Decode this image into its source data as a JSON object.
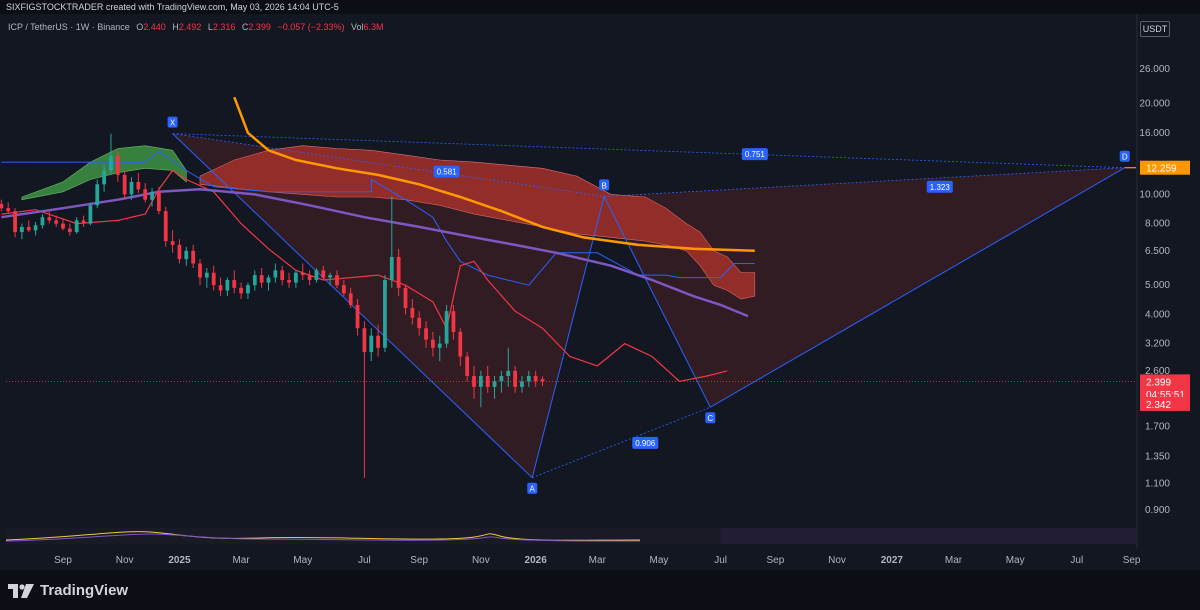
{
  "header": {
    "credit": "SIXFIGSTOCKTRADER created with TradingView.com, May 03, 2026 14:04 UTC-5",
    "symbol": "ICP / TetherUS · 1W · Binance",
    "open_label": "O",
    "open": "2.440",
    "high_label": "H",
    "high": "2.492",
    "low_label": "L",
    "low": "2.316",
    "close_label": "C",
    "close": "2.399",
    "change": "−0.057 (−2.33%)",
    "vol_label": "Vol",
    "vol": "6.3M",
    "currency": "USDT"
  },
  "brand": {
    "name": "TradingView"
  },
  "colors": {
    "up": "#26a69a",
    "down": "#f23645",
    "pattern_line": "#2962ff",
    "ema_orange": "#ff9800",
    "ma_purple": "#7e57c2",
    "cloud_red": "#a3302a",
    "cloud_green": "#3d8c40",
    "background": "#131722"
  },
  "chart_data": {
    "type": "candlestick",
    "scale": "log",
    "ylim": [
      0.82,
      33
    ],
    "y_ticks": [
      "26.000",
      "20.000",
      "16.000",
      "12.000",
      "10.000",
      "8.000",
      "6.500",
      "5.000",
      "4.000",
      "3.200",
      "2.600",
      "1.700",
      "1.350",
      "1.100",
      "0.900"
    ],
    "y_tick_values": [
      26,
      20,
      16,
      12,
      10,
      8,
      6.5,
      5,
      4,
      3.2,
      2.6,
      1.7,
      1.35,
      1.1,
      0.9
    ],
    "x_ticks": [
      "Sep",
      "Nov",
      "2025",
      "Mar",
      "May",
      "Jul",
      "Sep",
      "Nov",
      "2026",
      "Mar",
      "May",
      "Jul",
      "Sep",
      "Nov",
      "2027",
      "Mar",
      "May",
      "Jul",
      "Sep"
    ],
    "x_tick_weeks": [
      0,
      9,
      17,
      26,
      35,
      44,
      52,
      61,
      69,
      78,
      87,
      96,
      104,
      113,
      121,
      130,
      139,
      148,
      156
    ],
    "bold_ticks": [
      "2025",
      "2026",
      "2027"
    ],
    "first_week_date": "2024-08-26",
    "harmonic_points": [
      {
        "label": "X",
        "week": 16,
        "price": 15.9
      },
      {
        "label": "A",
        "week": 68.5,
        "price": 1.15
      },
      {
        "label": "B",
        "week": 79,
        "price": 9.85
      },
      {
        "label": "C",
        "week": 94.5,
        "price": 1.97
      },
      {
        "label": "D",
        "week": 155,
        "price": 12.259
      }
    ],
    "ratios": [
      {
        "label": "0.751",
        "week": 101,
        "price": 13.6
      },
      {
        "label": "0.581",
        "week": 56,
        "price": 11.9
      },
      {
        "label": "1.323",
        "week": 128,
        "price": 10.6
      },
      {
        "label": "0.906",
        "week": 85,
        "price": 1.5
      }
    ],
    "price_labels": [
      {
        "label": "12.259",
        "price": 12.259,
        "color": "#ff9800"
      },
      {
        "label": "2.399",
        "price": 2.399,
        "color": "#f23645"
      },
      {
        "label": "04:55:51",
        "price": 2.18,
        "color": "#f23645"
      },
      {
        "label": "2.342",
        "price": 2.02,
        "color": "#f23645"
      }
    ],
    "current_price": 2.399,
    "d_level": 12.259,
    "candles": [
      [
        9.3,
        9.6,
        8.8,
        9.0
      ],
      [
        9.0,
        9.4,
        8.6,
        8.8
      ],
      [
        8.8,
        9.0,
        7.2,
        7.5
      ],
      [
        7.5,
        8.0,
        7.1,
        7.8
      ],
      [
        7.8,
        8.2,
        7.5,
        7.6
      ],
      [
        7.6,
        8.1,
        7.3,
        7.9
      ],
      [
        7.9,
        8.6,
        7.7,
        8.4
      ],
      [
        8.4,
        8.8,
        8.0,
        8.2
      ],
      [
        8.2,
        8.5,
        7.8,
        8.0
      ],
      [
        8.0,
        8.3,
        7.6,
        7.7
      ],
      [
        7.7,
        8.0,
        7.3,
        7.5
      ],
      [
        7.5,
        8.4,
        7.4,
        8.2
      ],
      [
        8.2,
        8.5,
        7.8,
        8.0
      ],
      [
        8.0,
        9.4,
        7.9,
        9.2
      ],
      [
        9.2,
        11.2,
        9.0,
        10.8
      ],
      [
        10.8,
        12.5,
        10.2,
        12.0
      ],
      [
        12.0,
        15.9,
        11.6,
        13.4
      ],
      [
        13.4,
        13.9,
        11.0,
        11.6
      ],
      [
        11.6,
        12.0,
        9.6,
        10.0
      ],
      [
        10.0,
        11.4,
        9.6,
        11.0
      ],
      [
        11.0,
        11.8,
        10.1,
        10.4
      ],
      [
        10.4,
        10.9,
        9.4,
        9.6
      ],
      [
        9.6,
        10.5,
        9.1,
        10.2
      ],
      [
        10.2,
        10.6,
        8.6,
        8.8
      ],
      [
        8.8,
        9.1,
        6.7,
        7.0
      ],
      [
        7.0,
        7.6,
        6.4,
        6.8
      ],
      [
        6.8,
        7.1,
        5.9,
        6.1
      ],
      [
        6.1,
        6.7,
        5.8,
        6.5
      ],
      [
        6.5,
        6.8,
        5.7,
        5.9
      ],
      [
        5.9,
        6.1,
        5.0,
        5.3
      ],
      [
        5.3,
        5.7,
        4.9,
        5.5
      ],
      [
        5.5,
        5.8,
        4.8,
        5.0
      ],
      [
        5.0,
        5.3,
        4.6,
        4.8
      ],
      [
        4.8,
        5.3,
        4.6,
        5.2
      ],
      [
        5.2,
        5.6,
        4.7,
        4.9
      ],
      [
        4.9,
        5.1,
        4.5,
        4.7
      ],
      [
        4.7,
        5.1,
        4.5,
        5.0
      ],
      [
        5.0,
        5.6,
        4.8,
        5.4
      ],
      [
        5.4,
        5.7,
        4.9,
        5.1
      ],
      [
        5.1,
        5.4,
        4.8,
        5.3
      ],
      [
        5.3,
        5.9,
        5.1,
        5.6
      ],
      [
        5.6,
        5.8,
        5.0,
        5.2
      ],
      [
        5.2,
        5.5,
        4.9,
        5.1
      ],
      [
        5.1,
        5.6,
        4.9,
        5.5
      ],
      [
        5.5,
        5.9,
        5.2,
        5.4
      ],
      [
        5.4,
        5.6,
        5.0,
        5.2
      ],
      [
        5.2,
        5.7,
        5.1,
        5.6
      ],
      [
        5.6,
        5.8,
        5.2,
        5.3
      ],
      [
        5.3,
        5.5,
        5.0,
        5.4
      ],
      [
        5.4,
        5.6,
        4.9,
        5.0
      ],
      [
        5.0,
        5.2,
        4.6,
        4.7
      ],
      [
        4.7,
        4.9,
        4.2,
        4.3
      ],
      [
        4.3,
        4.5,
        3.4,
        3.6
      ],
      [
        3.6,
        3.8,
        1.15,
        3.0
      ],
      [
        3.0,
        3.6,
        2.8,
        3.4
      ],
      [
        3.4,
        3.7,
        2.9,
        3.1
      ],
      [
        3.1,
        5.4,
        3.0,
        5.2
      ],
      [
        5.2,
        9.85,
        4.9,
        6.2
      ],
      [
        6.2,
        6.6,
        4.6,
        4.9
      ],
      [
        4.9,
        5.0,
        4.0,
        4.2
      ],
      [
        4.2,
        4.5,
        3.7,
        3.9
      ],
      [
        3.9,
        4.1,
        3.4,
        3.6
      ],
      [
        3.6,
        3.8,
        3.1,
        3.3
      ],
      [
        3.3,
        3.5,
        2.9,
        3.1
      ],
      [
        3.1,
        3.4,
        2.8,
        3.2
      ],
      [
        3.2,
        4.3,
        3.1,
        4.1
      ],
      [
        4.1,
        4.3,
        3.3,
        3.5
      ],
      [
        3.5,
        3.6,
        2.7,
        2.9
      ],
      [
        2.9,
        3.0,
        2.4,
        2.5
      ],
      [
        2.5,
        2.7,
        2.1,
        2.3
      ],
      [
        2.3,
        2.6,
        1.97,
        2.5
      ],
      [
        2.5,
        2.7,
        2.2,
        2.3
      ],
      [
        2.3,
        2.5,
        2.1,
        2.4
      ],
      [
        2.4,
        2.6,
        2.2,
        2.5
      ],
      [
        2.5,
        3.1,
        2.3,
        2.6
      ],
      [
        2.6,
        2.7,
        2.2,
        2.3
      ],
      [
        2.3,
        2.5,
        2.2,
        2.4
      ],
      [
        2.4,
        2.6,
        2.3,
        2.5
      ],
      [
        2.5,
        2.6,
        2.3,
        2.4
      ],
      [
        2.44,
        2.492,
        2.316,
        2.399
      ]
    ],
    "candles_first_week": 0,
    "candle_week_step": 1.0
  }
}
